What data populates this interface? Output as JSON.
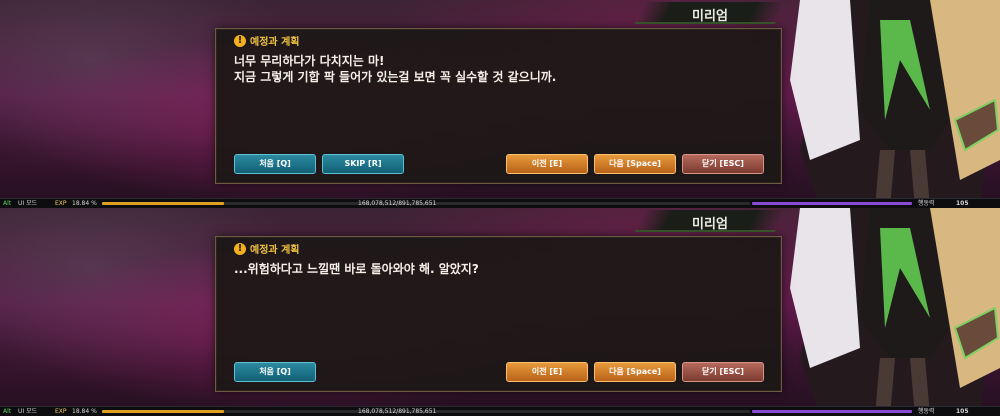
{
  "panels": [
    {
      "speaker": "미리엄",
      "header": {
        "title": "예정과 계획"
      },
      "lines": [
        "너무 무리하다가 다치지는 마!",
        "지금 그렇게 기합 팍 들어가 있는걸 보면 꼭 실수할 것 같으니까."
      ],
      "buttons": {
        "first": "처음 [Q]",
        "skip": "SKIP [R]",
        "prev": "이전 [E]",
        "next": "다음 [Space]",
        "close": "닫기 [ESC]"
      },
      "hud": {
        "alt": "Alt",
        "ui_mode": "UI 모드",
        "exp_label": "EXP",
        "exp_percent": "18.84 %",
        "exp_fraction": 0.1884,
        "exp_values": "168,078,512/891,785,651",
        "stamina_label": "행동력",
        "stamina_value": "105"
      }
    },
    {
      "speaker": "미리엄",
      "header": {
        "title": "예정과 계획"
      },
      "lines": [
        "...위험하다고 느낄땐 바로 돌아와야 해. 알았지?"
      ],
      "buttons": {
        "first": "처음 [Q]",
        "prev": "이전 [E]",
        "next": "다음 [Space]",
        "close": "닫기 [ESC]"
      },
      "hud": {
        "alt": "Alt",
        "ui_mode": "UI 모드",
        "exp_label": "EXP",
        "exp_percent": "18.84 %",
        "exp_fraction": 0.1884,
        "exp_values": "168,078,512/891,785,651",
        "stamina_label": "행동력",
        "stamina_value": "105"
      }
    }
  ],
  "colors": {
    "title": "#f0c040",
    "teal_button": "#126074",
    "orange_button": "#b8621a",
    "red_button": "#7c3a30",
    "exp_bar": "#e0a020",
    "stamina_bar": "#8a4ad8"
  }
}
